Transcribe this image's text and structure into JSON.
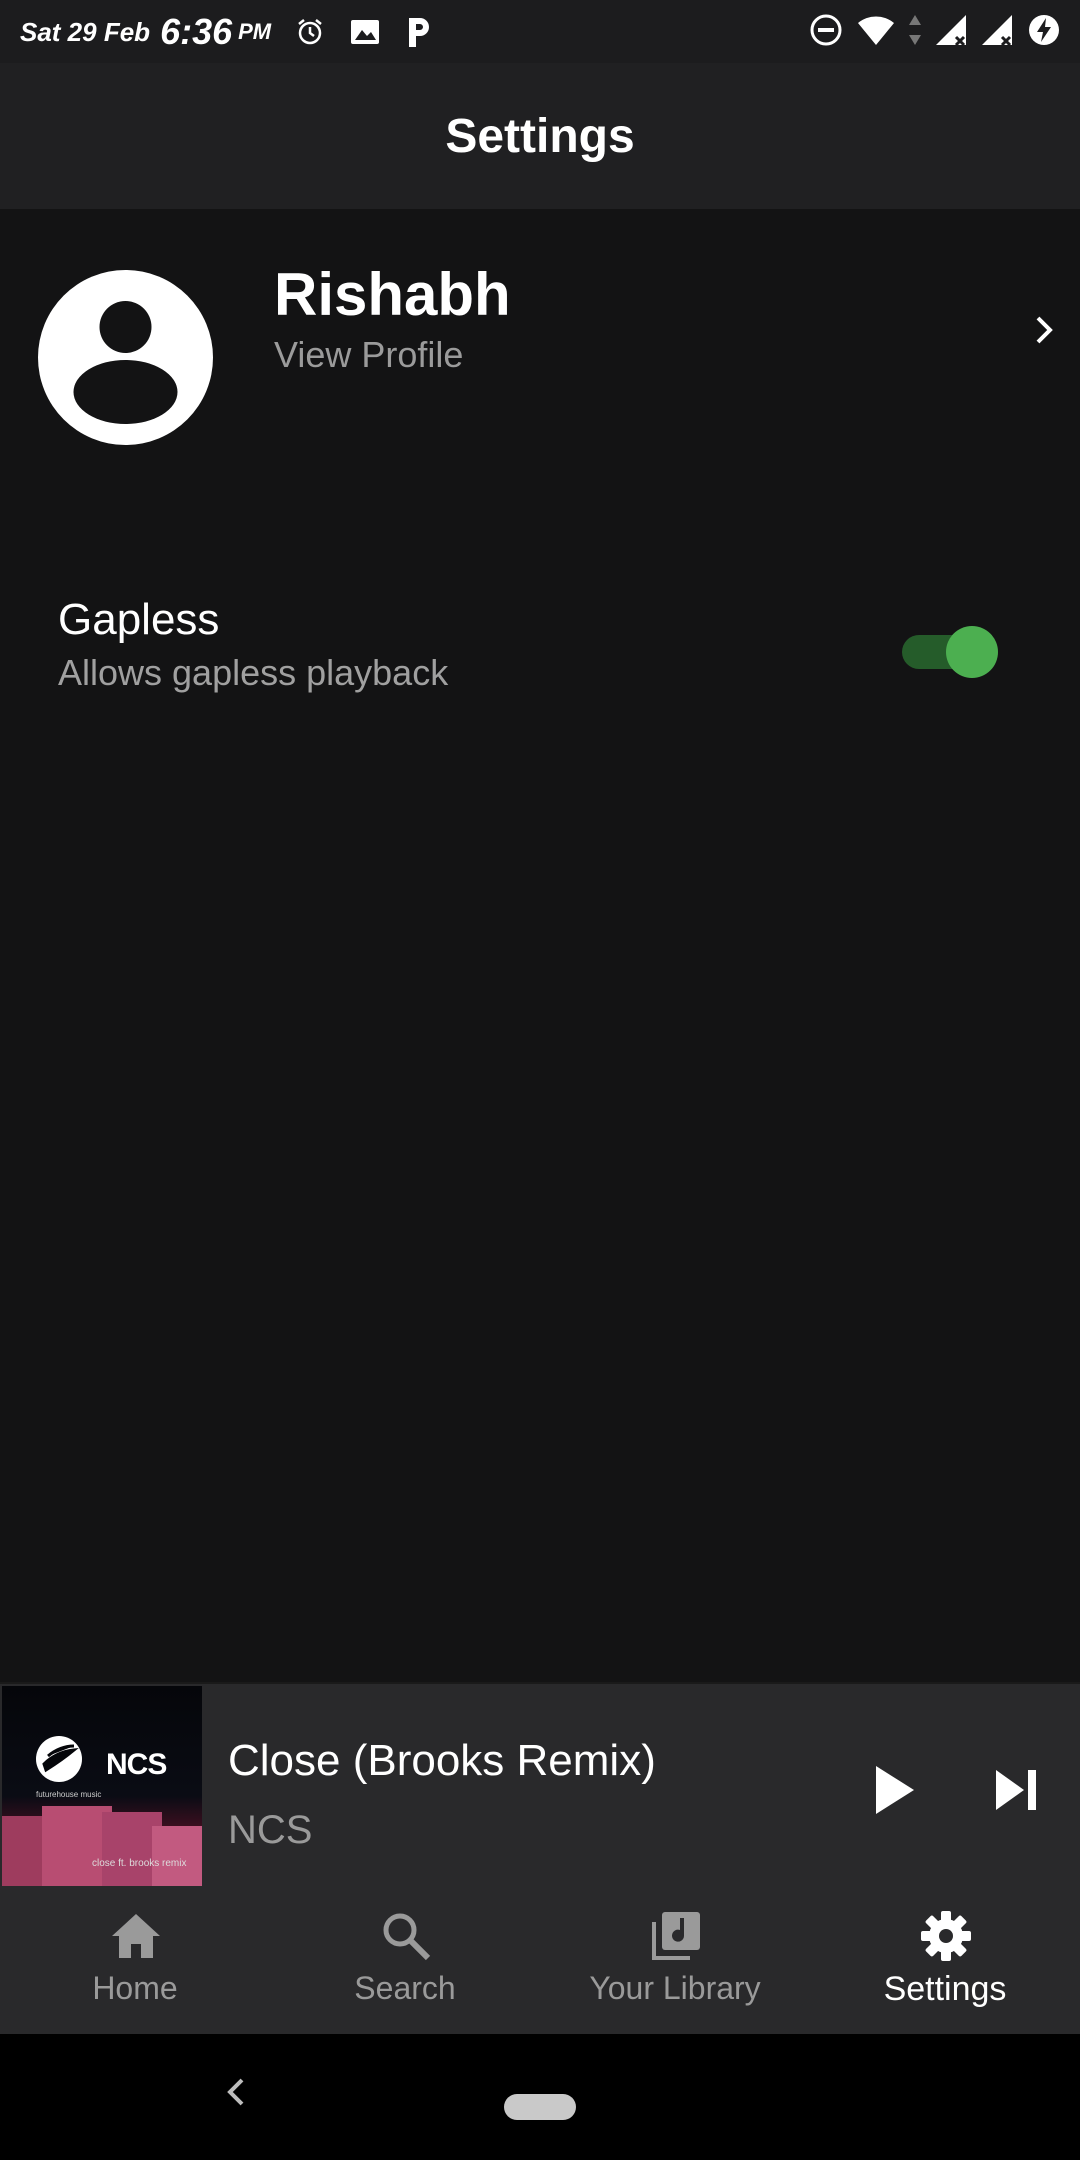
{
  "status_bar": {
    "date": "Sat 29 Feb",
    "time": "6:36",
    "ampm": "PM",
    "left_icons": [
      "alarm-icon",
      "image-icon",
      "p-icon"
    ],
    "right_icons": [
      "do-not-disturb-icon",
      "wifi-icon",
      "data-arrows-icon",
      "signal-icon",
      "signal-icon",
      "battery-charging-icon"
    ]
  },
  "app_bar": {
    "title": "Settings"
  },
  "profile": {
    "name": "Rishabh",
    "link": "View Profile",
    "avatar_icon": "account-circle-icon",
    "chevron_icon": "chevron-right-icon"
  },
  "settings": {
    "gapless": {
      "title": "Gapless",
      "subtitle": "Allows gapless playback",
      "enabled": true
    }
  },
  "player": {
    "title": "Close (Brooks Remix)",
    "artist": "NCS",
    "artwork": {
      "brand": "NCS",
      "subtext": "futurehouse music",
      "caption": "close ft. brooks remix"
    },
    "controls": [
      "play-icon",
      "skip-next-icon"
    ]
  },
  "bottom_nav": {
    "items": [
      {
        "label": "Home",
        "icon": "home-icon",
        "active": false
      },
      {
        "label": "Search",
        "icon": "search-icon",
        "active": false
      },
      {
        "label": "Your Library",
        "icon": "library-icon",
        "active": false
      },
      {
        "label": "Settings",
        "icon": "gear-icon",
        "active": true
      }
    ]
  },
  "colors": {
    "background": "#131314",
    "app_bar": "#202022",
    "accent": "#4caf50",
    "secondary_text": "#9a9a9a"
  }
}
